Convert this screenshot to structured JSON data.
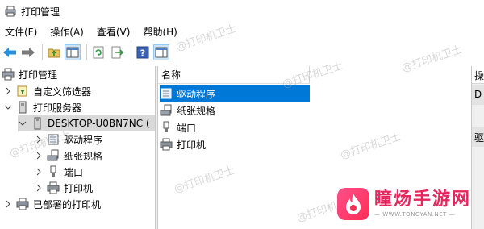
{
  "window": {
    "title": "打印管理"
  },
  "menu": [
    {
      "label": "文件(F)"
    },
    {
      "label": "操作(A)"
    },
    {
      "label": "查看(V)"
    },
    {
      "label": "帮助(H)"
    }
  ],
  "toolbar": {
    "buttons": [
      {
        "icon": "back-arrow-icon"
      },
      {
        "icon": "forward-arrow-icon"
      },
      {
        "icon": "up-folder-icon"
      },
      {
        "icon": "show-hide-tree-icon"
      },
      {
        "icon": "refresh-icon"
      },
      {
        "icon": "export-list-icon"
      },
      {
        "icon": "help-icon"
      },
      {
        "icon": "show-hide-action-pane-icon"
      }
    ]
  },
  "tree": {
    "root": "打印管理",
    "custom_filters": "自定义筛选器",
    "print_servers": "打印服务器",
    "server_name": "DESKTOP-U0BN7NC (",
    "children": [
      "驱动程序",
      "纸张规格",
      "端口",
      "打印机"
    ],
    "deployed": "已部署的打印机"
  },
  "list": {
    "column_name": "名称",
    "items": [
      "驱动程序",
      "纸张规格",
      "端口",
      "打印机"
    ],
    "selected_index": 0
  },
  "right_pane": {
    "header": "操",
    "row1": "D",
    "row2": "驱"
  },
  "watermark": "@打印机卫士",
  "brand": {
    "name": "瞳炀手游网",
    "url": "— WWW.TONGYAN.NET —"
  },
  "colors": {
    "selection_blue": "#0078d7",
    "tree_selected": "#d9d9d9",
    "brand_pink": "#e8265e"
  }
}
